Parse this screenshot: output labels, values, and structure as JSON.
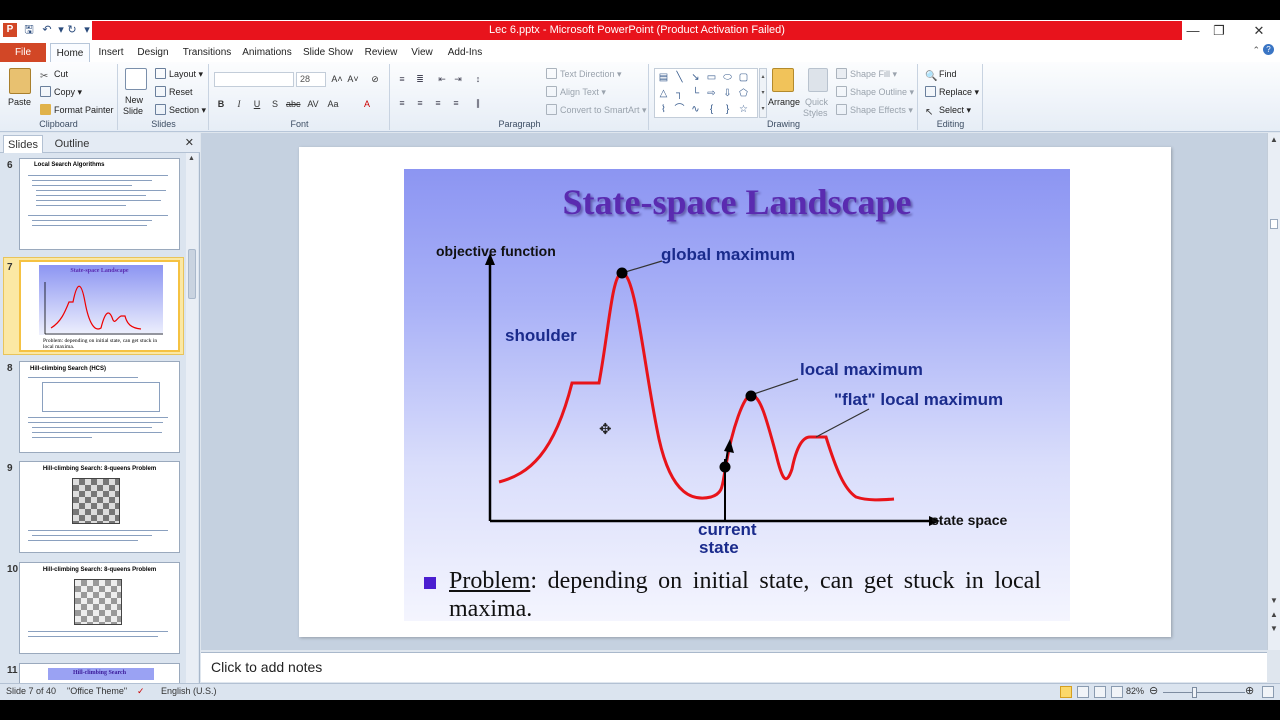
{
  "window": {
    "title": "Lec 6.pptx - Microsoft PowerPoint (Product Activation Failed)"
  },
  "ribbon_tabs": [
    "File",
    "Home",
    "Insert",
    "Design",
    "Transitions",
    "Animations",
    "Slide Show",
    "Review",
    "View",
    "Add-Ins"
  ],
  "clipboard": {
    "paste": "Paste",
    "cut": "Cut",
    "copy": "Copy",
    "format_painter": "Format Painter",
    "label": "Clipboard"
  },
  "slides_group": {
    "new_slide": "New",
    "new_slide2": "Slide",
    "layout": "Layout",
    "reset": "Reset",
    "section": "Section",
    "label": "Slides"
  },
  "font_group": {
    "font_size": "28",
    "label": "Font"
  },
  "paragraph_group": {
    "text_direction": "Text Direction",
    "align_text": "Align Text",
    "convert_smartart": "Convert to SmartArt",
    "label": "Paragraph"
  },
  "drawing_group": {
    "arrange": "Arrange",
    "quick_styles": "Quick",
    "quick_styles2": "Styles",
    "shape_fill": "Shape Fill",
    "shape_outline": "Shape Outline",
    "shape_effects": "Shape Effects",
    "label": "Drawing"
  },
  "editing_group": {
    "find": "Find",
    "replace": "Replace",
    "select": "Select",
    "label": "Editing"
  },
  "panel_tabs": {
    "slides": "Slides",
    "outline": "Outline"
  },
  "thumbnails": [
    {
      "num": "6",
      "title": "Local Search Algorithms"
    },
    {
      "num": "7",
      "title": "State-space Landscape",
      "caption": "Problem: depending on initial state, can get stuck in local maxima."
    },
    {
      "num": "8",
      "title": "Hill-climbing Search (HCS)"
    },
    {
      "num": "9",
      "title": "Hill-climbing Search: 8-queens Problem"
    },
    {
      "num": "10",
      "title": "Hill-climbing Search: 8-queens Problem"
    },
    {
      "num": "11",
      "title": "Hill-climbing Search"
    }
  ],
  "slide": {
    "title": "State-space Landscape",
    "labels": {
      "objective_function": "objective function",
      "global_maximum": "global maximum",
      "shoulder": "shoulder",
      "local_maximum": "local maximum",
      "flat_local_maximum": "\"flat\" local maximum",
      "current": "current",
      "state": "state",
      "state_space": "state space"
    },
    "problem_word": "Problem",
    "problem_rest": ": depending on initial state, can get stuck in local maxima."
  },
  "notes_placeholder": "Click to add notes",
  "status": {
    "slide_of": "Slide 7 of 40",
    "theme": "\"Office Theme\"",
    "language": "English (U.S.)",
    "zoom": "82%"
  }
}
